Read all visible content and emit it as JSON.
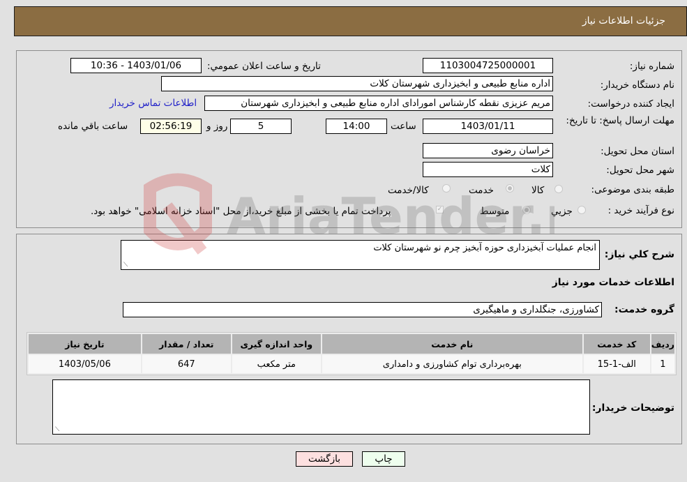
{
  "header": {
    "title": "جزئیات اطلاعات نیاز"
  },
  "form": {
    "need_number": {
      "label": "شماره نیاز:",
      "value": "1103004725000001"
    },
    "announce_datetime": {
      "label": "تاریخ و ساعت اعلان عمومي:",
      "value": "1403/01/06 - 10:36"
    },
    "buyer_org": {
      "label": "نام دستگاه خریدار:",
      "value": "اداره منابع طبیعی و ابخیزداری شهرستان کلات"
    },
    "requester": {
      "label": "ایجاد کننده درخواست:",
      "value": "مریم عزیزی نقطه کارشناس امورادای اداره منابع طبیعی و ابخیزداری شهرستان",
      "contact_link": "اطلاعات تماس خریدار"
    },
    "deadline": {
      "label": "مهلت ارسال پاسخ: تا تاریخ:",
      "date": "1403/01/11",
      "time_label": "ساعت",
      "time": "14:00",
      "days": "5",
      "days_label": "روز و",
      "remaining": "02:56:19",
      "remaining_label": "ساعت باقي مانده"
    },
    "province": {
      "label": "استان محل تحویل:",
      "value": "خراسان رضوی"
    },
    "city": {
      "label": "شهر محل تحویل:",
      "value": "کلات"
    },
    "category": {
      "label": "طبقه بندی موضوعی:",
      "options": [
        "کالا",
        "خدمت",
        "کالا/خدمت"
      ],
      "selected": "خدمت"
    },
    "purchase_type": {
      "label": "نوع فرآیند خرید :",
      "options": [
        "جزيي",
        "متوسط"
      ],
      "selected": "متوسط",
      "treasury_note": "پرداخت تمام یا بخشی از مبلغ خرید،از محل \"اسناد خزانه اسلامی\" خواهد بود.",
      "treasury_checked": true
    }
  },
  "details": {
    "description_label": "شرح کلي نیاز:",
    "description": "انجام عملیات آبخیزداری حوزه آبخیز چرم نو شهرستان کلات",
    "services_heading": "اطلاعات خدمات مورد نیاز",
    "service_group_label": "گروه خدمت:",
    "service_group": "کشاورزی، جنگلداری و ماهیگیری",
    "table": {
      "headers": [
        "ردیف",
        "کد خدمت",
        "نام خدمت",
        "واحد اندازه گیری",
        "تعداد / مقدار",
        "تاریخ نیاز"
      ],
      "rows": [
        [
          "1",
          "الف-1-15",
          "بهره‌برداری توام کشاورزی و دامداری",
          "متر مکعب",
          "647",
          "1403/05/06"
        ]
      ]
    },
    "buyer_notes_label": "توضیحات خریدار:",
    "buyer_notes": ""
  },
  "buttons": {
    "print": "چاپ",
    "back": "بازگشت"
  },
  "watermark": {
    "text": "AriaTender.net"
  },
  "colors": {
    "header_bg": "#8b6d42",
    "link": "#2020c8",
    "print_bg": "#eefeee",
    "back_bg": "#fde0e0"
  }
}
